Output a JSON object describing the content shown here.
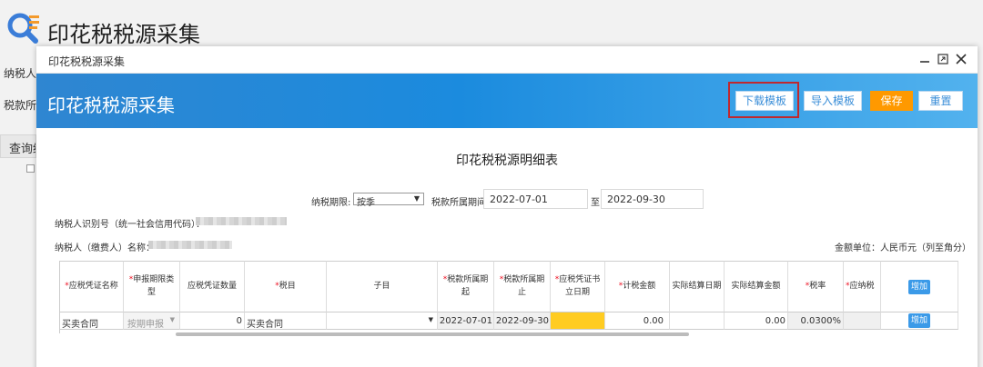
{
  "background": {
    "page_title": "印花税税源采集",
    "label_taxpayer": "纳税人识",
    "label_period": "税款所属",
    "query_tab": "查询结"
  },
  "modal": {
    "window_title": "印花税税源采集",
    "banner_title": "印花税税源采集",
    "toolbar": {
      "download_template": "下载模板",
      "import_template": "导入模板",
      "save": "保存",
      "reset": "重置"
    },
    "sheet_title": "印花税税源明细表",
    "filters": {
      "term_label": "纳税期限:",
      "term_value": "按季",
      "period_label": "税款所属期间:",
      "period_start": "2022-07-01",
      "period_sep": "至",
      "period_end": "2022-09-30"
    },
    "taxpayer_id_label": "纳税人识别号（统一社会信用代码）：",
    "taxpayer_name_label": "纳税人（缴费人）名称：",
    "amount_unit": "金额单位：人民币元（列至角分）",
    "table": {
      "headers": [
        {
          "req": true,
          "text": "应税凭证名称"
        },
        {
          "req": true,
          "text": "申报期限类型"
        },
        {
          "req": false,
          "text": "应税凭证数量"
        },
        {
          "req": true,
          "text": "税目"
        },
        {
          "req": false,
          "text": "子目"
        },
        {
          "req": true,
          "text": "税款所属期起"
        },
        {
          "req": true,
          "text": "税款所属期止"
        },
        {
          "req": true,
          "text": "应税凭证书立日期"
        },
        {
          "req": true,
          "text": "计税金额"
        },
        {
          "req": false,
          "text": "实际结算日期"
        },
        {
          "req": false,
          "text": "实际结算金额"
        },
        {
          "req": true,
          "text": "税率"
        },
        {
          "req": true,
          "text": "应纳税"
        }
      ],
      "add_button": "增加",
      "row": {
        "voucher_name": "买卖合同",
        "period_type": "按期申报",
        "quantity": "0",
        "tax_item": "买卖合同",
        "sub_item": "",
        "period_start": "2022-07-01",
        "period_end": "2022-09-30",
        "sign_date": "",
        "taxable_amount": "0.00",
        "settle_date": "",
        "settle_amount": "0.00",
        "tax_rate": "0.0300%",
        "tax_payable": "",
        "add_button": "增加"
      }
    }
  },
  "colors": {
    "banner": "#1b8bde",
    "save_button": "#ff9900",
    "highlight": "#c0282e",
    "sign_date_fill": "#ffcc22",
    "required_mark": "#e11122"
  }
}
